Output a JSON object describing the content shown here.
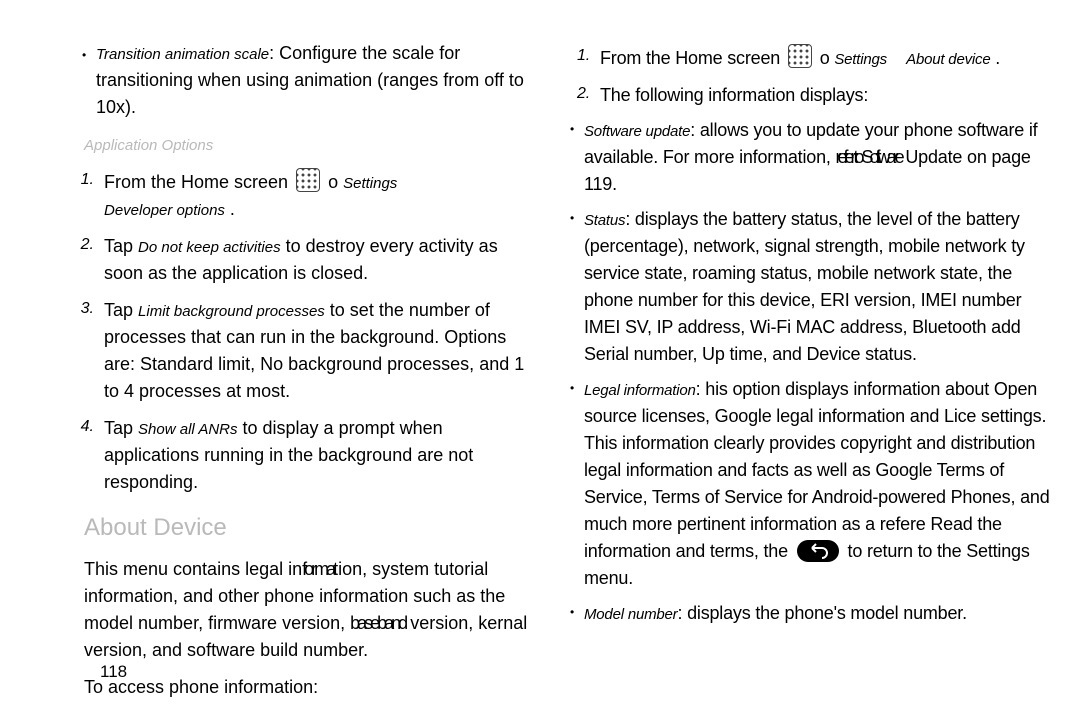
{
  "page_number": "118",
  "left": {
    "transition_term": "Transition animation scale",
    "transition_text": ": Configure the scale for transitioning when using animation (ranges from off to 10x).",
    "app_options_heading": "Application Options",
    "step1a": "From the Home screen",
    "step1b": "Settings",
    "step1c": "Developer options",
    "tap": "Tap ",
    "step2_term": "Do not keep activities",
    "step2_text": " to destroy every activity as soon as the application is closed.",
    "step3_term": "Limit background processes",
    "step3_text": " to set the number of processes that can run in the background. Options are: Standard limit, No background processes, and 1 to 4 processes at most.",
    "step4_term": "Show all ANRs",
    "step4_text": " to display a prompt when applications running in the background are not responding.",
    "about_heading": "About Device",
    "about_p1a": "This menu contains legal in",
    "about_p1a_ovr": "forma",
    "about_p1b": "tion, system tutorial information, and other phone information such as the model number, firmware version, ",
    "about_p1b_ovr": "baseband",
    "about_p1c": " version, kernal version, and software build number.",
    "about_p2": "To access phone information:"
  },
  "right": {
    "r1a": "From the Home screen",
    "r1_b": "Settings",
    "r1_c": "About device",
    "r2": "The following information displays:",
    "su_term": "Software update",
    "su_text_a": ": allows you to update your phone software if available. For more information, ",
    "su_ovr": "refer to Software",
    "su_text_b": " Update on page 119.",
    "st_term": "Status",
    "st_text": ": displays the battery status, the level of the battery (percentage), network, signal strength, mobile network ty service state, roaming status, mobile network state, the phone number for this device, ERI version, IMEI number IMEI SV, IP address, Wi-Fi MAC address, Bluetooth add Serial number, Up time, and Device status.",
    "li_term": "Legal information",
    "li_text_a": ": his option displays information about Open source licenses, Google legal information and Lice settings. This information clearly provides copyright and distribution legal information and facts as well as Google Terms of Service, Terms of Service for Android-powered Phones, and much more pertinent information as a refere Read the information and terms, the",
    "li_text_b": " to return to the Settings menu.",
    "mn_term": "Model number",
    "mn_text": ": displays the phone's model number."
  },
  "digits": {
    "n1": "1.",
    "n2": "2.",
    "n3": "3.",
    "n4": "4."
  }
}
